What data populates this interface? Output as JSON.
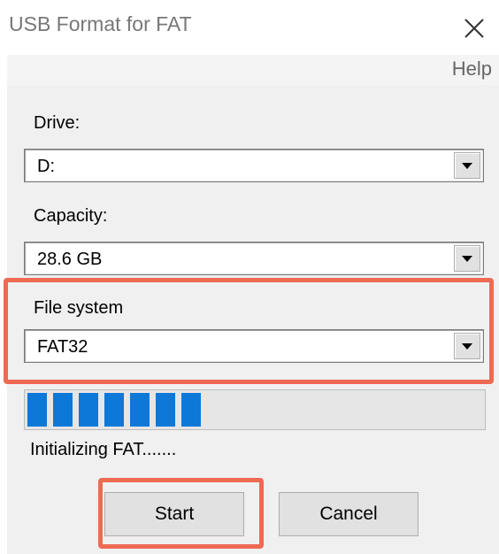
{
  "window": {
    "title": "USB Format for FAT",
    "close_glyph": "✕",
    "close_icon": "close-icon"
  },
  "menu": {
    "help": "Help"
  },
  "drive": {
    "label": "Drive:",
    "value": "D:"
  },
  "capacity": {
    "label": "Capacity:",
    "value": "28.6 GB"
  },
  "file_system": {
    "label": "File system",
    "value": "FAT32"
  },
  "progress": {
    "fraction": 0.39,
    "color": "#0e78d8"
  },
  "status": {
    "text": "Initializing FAT......."
  },
  "buttons": {
    "start": "Start",
    "cancel": "Cancel"
  },
  "colors": {
    "highlight": "#ee6a52"
  }
}
